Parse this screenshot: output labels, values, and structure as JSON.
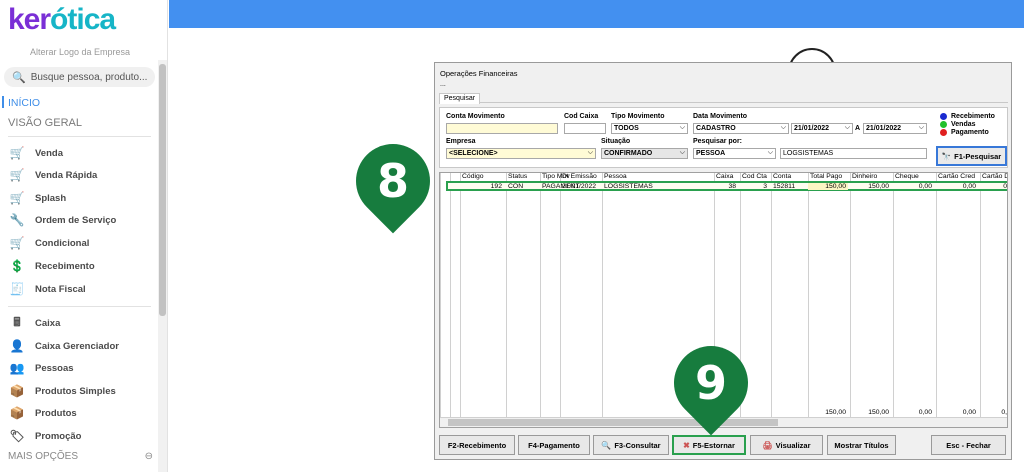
{
  "sidebar": {
    "logo_a": "ker",
    "logo_b": "ótica",
    "logo_sub": "Alterar Logo da Empresa",
    "search_placeholder": "Busque pessoa, produto...",
    "inicio": "INÍCIO",
    "visao": "VISÃO GERAL",
    "mais": "MAIS OPÇÕES",
    "items": [
      {
        "label": "Venda",
        "icon": "cart-icon",
        "glyph": "🛒"
      },
      {
        "label": "Venda Rápida",
        "icon": "cart-fast-icon",
        "glyph": "🛒"
      },
      {
        "label": "Splash",
        "icon": "cart-splash-icon",
        "glyph": "🛒"
      },
      {
        "label": "Ordem de Serviço",
        "icon": "wrench-icon",
        "glyph": "🔧"
      },
      {
        "label": "Condicional",
        "icon": "cart-conditional-icon",
        "glyph": "🛒"
      },
      {
        "label": "Recebimento",
        "icon": "money-hand-icon",
        "glyph": "💲"
      },
      {
        "label": "Nota Fiscal",
        "icon": "invoice-icon",
        "glyph": "🧾"
      },
      {
        "label": "Caixa",
        "icon": "cash-register-icon",
        "glyph": "🖩"
      },
      {
        "label": "Caixa Gerenciador",
        "icon": "user-cash-icon",
        "glyph": "👤"
      },
      {
        "label": "Pessoas",
        "icon": "people-icon",
        "glyph": "👥"
      },
      {
        "label": "Produtos Simples",
        "icon": "box-icon",
        "glyph": "📦"
      },
      {
        "label": "Produtos",
        "icon": "box-icon",
        "glyph": "📦"
      },
      {
        "label": "Promoção",
        "icon": "tag-icon",
        "glyph": "🏷"
      }
    ]
  },
  "window": {
    "title": "Operações Financeiras",
    "dots": "...",
    "tab": "Pesquisar",
    "filters": {
      "conta_lbl": "Conta Movimento",
      "conta_val": "",
      "codcaixa_lbl": "Cod Caixa",
      "codcaixa_val": "",
      "tipo_lbl": "Tipo Movimento",
      "tipo_val": "TODOS",
      "data_lbl": "Data Movimento",
      "data_tipo": "CADASTRO",
      "data_de": "21/01/2022",
      "data_a": "A",
      "data_ate": "21/01/2022",
      "empresa_lbl": "Empresa",
      "empresa_val": "<SELECIONE>",
      "situacao_lbl": "Situação",
      "situacao_val": "CONFIRMADO",
      "pesq_lbl": "Pesquisar por:",
      "pesq_tipo": "PESSOA",
      "pesq_val": "LOGSISTEMAS",
      "search_btn": "F1-Pesquisar"
    },
    "legend": [
      {
        "label": "Recebimento",
        "color": "#1a2ad0"
      },
      {
        "label": "Vendas",
        "color": "#22c02a"
      },
      {
        "label": "Pagamento",
        "color": "#e02020"
      }
    ],
    "columns": [
      "Código",
      "Status",
      "Tipo Mov",
      "Dt Emissão",
      "Pessoa",
      "Caixa",
      "Cod Cta",
      "Conta",
      "Total Pago",
      "Dinheiro",
      "Cheque",
      "Cartão Cred",
      "Cartão D"
    ],
    "row": [
      "192",
      "CON",
      "PAGAMENTO",
      "21/01/2022",
      "LOGSISTEMAS",
      "38",
      "3",
      "152811",
      "150,00",
      "150,00",
      "0,00",
      "0,00",
      "0"
    ],
    "totals": [
      "150,00",
      "150,00",
      "0,00",
      "0,00",
      "0,"
    ],
    "buttons": [
      "F2-Recebimento",
      "F4-Pagamento",
      "F3-Consultar",
      "F5-Estornar",
      "Visualizar",
      "Mostrar Títulos",
      "Esc - Fechar"
    ]
  },
  "markers": [
    "8",
    "9"
  ],
  "colors": {
    "topbar": "#4390f0",
    "marker": "#177c3e",
    "highlight": "#2aa04e"
  }
}
